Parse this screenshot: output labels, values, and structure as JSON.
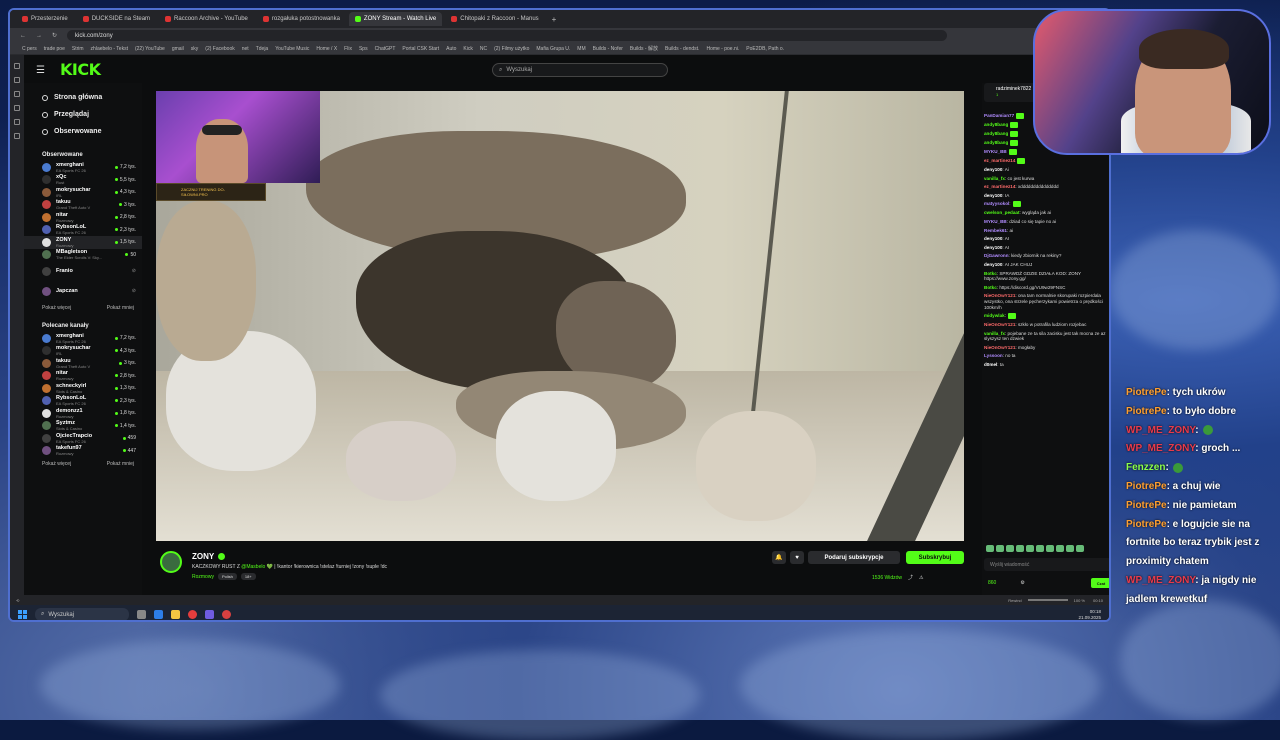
{
  "browser": {
    "tabs": [
      {
        "label": "Przesterzenie"
      },
      {
        "label": "DUCKSIDE na Steam"
      },
      {
        "label": "Raccoon Archive - YouTube"
      },
      {
        "label": "rozgałuka potostnowanka"
      },
      {
        "label": "ZONY Stream - Watch Live"
      },
      {
        "label": "Chitopaki z Raccoon - Manus"
      }
    ],
    "url": "kick.com/zony",
    "bookmarks": [
      "C pers",
      "trade poe",
      "Strim",
      "zhlaebelo - Tekst",
      "(22) YouTube",
      "gmail",
      "sky",
      "(2) Facebook",
      "net",
      "Tdeja",
      "YouTube Music",
      "Home / X",
      "Flix",
      "Sps",
      "ChatGPT",
      "Portal CSK Start",
      "Auto",
      "Kick",
      "NC",
      "(2) Filmy użytko",
      "Mafia Grupa U.",
      "MM",
      "Builds - Nofer",
      "Builds - 解放",
      "Builds - dendst.",
      "Home - poe.ni.",
      "PoE2DB, Path o."
    ]
  },
  "kick": {
    "logo": "KICK",
    "search_placeholder": "Wyszukaj",
    "nav": [
      {
        "label": "Strona główna"
      },
      {
        "label": "Przeglądaj"
      },
      {
        "label": "Obserwowane"
      }
    ],
    "followed_title": "Obserwowane",
    "followed": [
      {
        "name": "xmerghani",
        "category": "EA Sports FC 26",
        "viewers": "7,2 tys."
      },
      {
        "name": "xQc",
        "category": "Rust",
        "viewers": "5,5 tys."
      },
      {
        "name": "mokrysuchar",
        "category": "IRL",
        "viewers": "4,3 tys."
      },
      {
        "name": "takuu",
        "category": "Grand Theft Auto V",
        "viewers": "3 tys."
      },
      {
        "name": "nitar",
        "category": "Rozmowy",
        "viewers": "2,8 tys."
      },
      {
        "name": "RybsonLoL",
        "category": "EA Sports FC 26",
        "viewers": "2,3 tys."
      },
      {
        "name": "ZONY",
        "category": "Rozmowy",
        "viewers": "1,5 tys."
      },
      {
        "name": "MBagletson",
        "category": "The Elder Scrolls V: Sky...",
        "viewers": "50"
      },
      {
        "name": "Franio",
        "category": "",
        "viewers": ""
      },
      {
        "name": "Japczan",
        "category": "",
        "viewers": ""
      }
    ],
    "show_more": "Pokaż więcej",
    "show_less": "Pokaż mniej",
    "recommended_title": "Polecane kanały",
    "recommended": [
      {
        "name": "xmerghani",
        "category": "EA Sports FC 26",
        "viewers": "7,2 tys."
      },
      {
        "name": "mokrysuchar",
        "category": "IRL",
        "viewers": "4,3 tys."
      },
      {
        "name": "takuu",
        "category": "Grand Theft Auto V",
        "viewers": "3 tys."
      },
      {
        "name": "nitar",
        "category": "Rozmowy",
        "viewers": "2,8 tys."
      },
      {
        "name": "schneckyirl",
        "category": "Slots & Casino",
        "viewers": "1,3 tys."
      },
      {
        "name": "RybsonLoL",
        "category": "EA Sports FC 26",
        "viewers": "2,3 tys."
      },
      {
        "name": "demonzz1",
        "category": "Rozmowy",
        "viewers": "1,8 tys."
      },
      {
        "name": "Syztmz",
        "category": "Slots & Casino",
        "viewers": "1,4 tys."
      },
      {
        "name": "OjciecTrapcio",
        "category": "EA Sports FC 26",
        "viewers": "459"
      },
      {
        "name": "takefun97",
        "category": "Rozmowy",
        "viewers": "447"
      }
    ],
    "cam_badge": "ZACZNIJ TRENING DO-SIŁOWNI.PRO",
    "stream": {
      "name": "ZONY",
      "title_prefix": "KACZKOWY RUST Z ",
      "title_mention": "@Masbelo",
      "title_suffix": " 💚 | !kantor !kierownica !stelaz !turniej !zony !suple !dc",
      "category": "Rozmowy",
      "tags": [
        "Polish",
        "18+"
      ],
      "gift_sub": "Podaruj subskrypcje",
      "subscribe": "Subskrybuj",
      "viewers": "1536 Widzów"
    },
    "chat": {
      "pinned_user": "radziminek7822",
      "pinned_sub": "1",
      "messages": [
        {
          "user": "PanDamian77",
          "text": "",
          "color": "#b18cff"
        },
        {
          "user": "andy8bang",
          "text": "",
          "color": "#53fc18"
        },
        {
          "user": "andy8bang",
          "text": "",
          "color": "#53fc18"
        },
        {
          "user": "andy8bang",
          "text": "",
          "color": "#53fc18"
        },
        {
          "user": "MYKU_BB",
          "text": "",
          "color": "#b18cff"
        },
        {
          "user": "ez_martinez14",
          "text": "",
          "color": "#ff6b6b"
        },
        {
          "user": "deny100",
          "text": ": Ai",
          "color": "#ffffff"
        },
        {
          "user": "vanilla_fx",
          "text": ": co jest kurwa",
          "color": "#53fc18"
        },
        {
          "user": "ez_martinez14",
          "text": ": xddddddddddddddd",
          "color": "#ff6b6b"
        },
        {
          "user": "deny100",
          "text": ": IA",
          "color": "#ffffff"
        },
        {
          "user": "matyysokol",
          "text": ":",
          "color": "#b18cff"
        },
        {
          "user": "cwelson_pedaat",
          "text": ": wygląda jak ai",
          "color": "#53fc18"
        },
        {
          "user": "MYKU_BB",
          "text": ": dziad co się tapie no ai",
          "color": "#b18cff"
        },
        {
          "user": "Rembek61",
          "text": ": ai",
          "color": "#b18cff"
        },
        {
          "user": "deny100",
          "text": ": AI",
          "color": "#ffffff"
        },
        {
          "user": "deny100",
          "text": ": AI",
          "color": "#ffffff"
        },
        {
          "user": "DjGawronn",
          "text": ": kiedy zbiornik na rekiny?",
          "color": "#b18cff"
        },
        {
          "user": "deny100",
          "text": ": AI JAK CHUJ",
          "color": "#ffffff"
        },
        {
          "user": "Botkc",
          "text": ": SPRAWDŹ GDZIE DZIAŁA KOD: ZONY https://www.zony.gg/",
          "color": "#53fc18"
        },
        {
          "user": "Botkc",
          "text": ": https://discord.gg/VU9w29FNSC",
          "color": "#53fc18"
        },
        {
          "user": "NieOnOwY121",
          "text": ": ona tam normalnie skorupaki rozpierdala wszystko, ona strzele pęcherzykami powietrza o prędkości 100km/h",
          "color": "#ff6b6b"
        },
        {
          "user": "midywlak",
          "text": ":",
          "color": "#53fc18"
        },
        {
          "user": "NieOnOwY121",
          "text": ": szkło w potrafila ludziom rozjebac",
          "color": "#ff6b6b"
        },
        {
          "user": "vanilla_fx",
          "text": ": pojebane ze ta sila zacisku jest tak mocna ze az slyszysz ten dzwiek",
          "color": "#53fc18"
        },
        {
          "user": "NieOnOwY121",
          "text": ": mogłaby",
          "color": "#ff6b6b"
        },
        {
          "user": "Lyssoon",
          "text": ": no ta",
          "color": "#b18cff"
        },
        {
          "user": "d0mel",
          "text": ": ta",
          "color": "#ffffff"
        }
      ],
      "input_placeholder": "Wyślij wiadomość",
      "points": "860",
      "send": "Czat"
    }
  },
  "player_controls": {
    "label": "Rewind",
    "volume": "100 %",
    "time": "00:10"
  },
  "taskbar": {
    "search": "Wyszukaj",
    "time": "00:18",
    "date": "21.09.2025"
  },
  "overlay_chat": [
    {
      "user": "PiotrePe",
      "text": ": tych ukrów",
      "color": "orange"
    },
    {
      "user": "PiotrePe",
      "text": ": to było dobre",
      "color": "orange"
    },
    {
      "user": "WP_ME_ZONY",
      "text": ":",
      "color": "red"
    },
    {
      "user": "WP_ME_ZONY",
      "text": ": groch ...",
      "color": "red"
    },
    {
      "user": "Fenzzen",
      "text": ":",
      "color": "green"
    },
    {
      "user": "PiotrePe",
      "text": ": a chuj wie",
      "color": "orange"
    },
    {
      "user": "PiotrePe",
      "text": ": nie pamietam",
      "color": "orange"
    },
    {
      "user": "PiotrePe",
      "text": ": e logujcie sie na fortnite bo teraz trybik jest z proximity chatem",
      "color": "orange"
    },
    {
      "user": "WP_ME_ZONY",
      "text": ": ja nigdy nie jadlem krewetkuf",
      "color": "red"
    }
  ]
}
